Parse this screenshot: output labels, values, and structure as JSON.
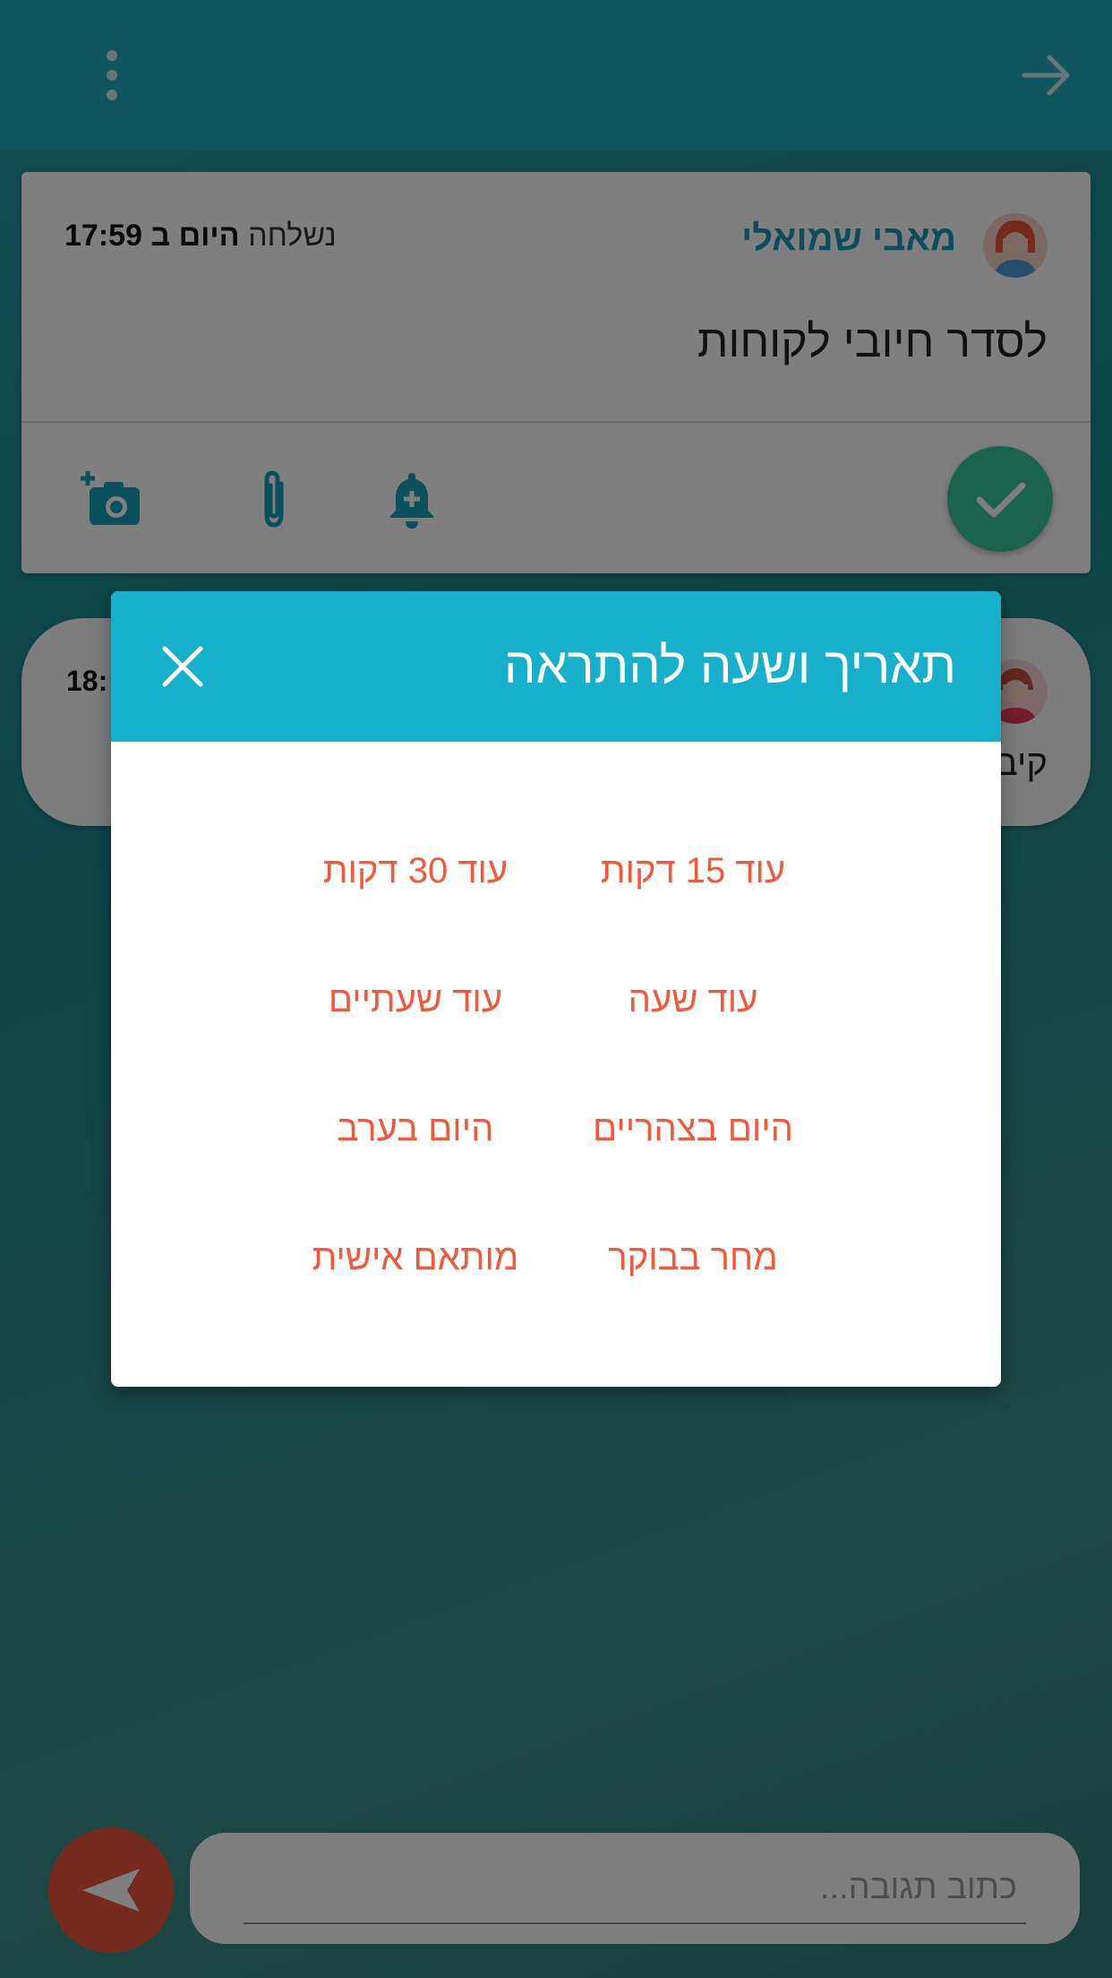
{
  "header": {
    "menu_icon": "more-vert-icon",
    "back_icon": "arrow-forward-icon"
  },
  "task_card": {
    "author": "מאבי שמואלי",
    "sent_label": "נשלחה",
    "sent_time_bold": "היום ב 17:59",
    "message": "לסדר חיובי לקוחות",
    "icons": [
      "add-photo-icon",
      "attach-icon",
      "add-alert-icon",
      "check-icon"
    ]
  },
  "second_card": {
    "time": "18:",
    "snippet": "קיב"
  },
  "dialog": {
    "title": "תאריך ושעה להתראה",
    "close_icon": "close-icon",
    "options": {
      "opt_15": "עוד 15 דקות",
      "opt_30": "עוד 30 דקות",
      "opt_hour": "עוד שעה",
      "opt_2h": "עוד שעתיים",
      "opt_noon": "היום בצהריים",
      "opt_evening": "היום בערב",
      "opt_tomorrow": "מחר בבוקר",
      "opt_custom": "מותאם אישית"
    }
  },
  "reply": {
    "placeholder": "כתוב תגובה...",
    "send_icon": "send-icon"
  },
  "colors": {
    "teal": "#17b0cb",
    "accent": "#f05a3a",
    "check": "#36c69b"
  }
}
